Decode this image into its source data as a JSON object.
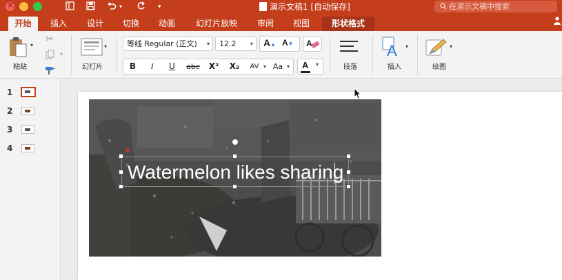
{
  "window": {
    "title": "演示文稿1 [自动保存]",
    "search_placeholder": "在演示文稿中搜索"
  },
  "tabs": [
    {
      "label": "开始",
      "active": true
    },
    {
      "label": "插入"
    },
    {
      "label": "设计"
    },
    {
      "label": "切换"
    },
    {
      "label": "动画"
    },
    {
      "label": "幻灯片放映"
    },
    {
      "label": "审阅"
    },
    {
      "label": "视图"
    },
    {
      "label": "形状格式",
      "contextual": true
    }
  ],
  "ribbon": {
    "paste_label": "粘贴",
    "slide_label": "幻灯片",
    "font_name": "等线 Regular (正文)",
    "font_size": "12.2",
    "grow_font": "A",
    "shrink_font": "A",
    "bold": "B",
    "italic": "I",
    "underline": "U",
    "strike": "abc",
    "superscript": "X²",
    "subscript": "X₂",
    "char_spacing": "AV",
    "change_case": "Aa",
    "font_color": "A",
    "paragraph_label": "段落",
    "insert_label": "插入",
    "drawing_label": "绘图"
  },
  "slides_panel": {
    "numbers": [
      "1",
      "2",
      "3",
      "4"
    ],
    "selected": "1"
  },
  "slide": {
    "text": "Watermelon likes sharing"
  },
  "colors": {
    "accent": "#c43e1c",
    "ribbon_bg": "#f3f3f3"
  }
}
